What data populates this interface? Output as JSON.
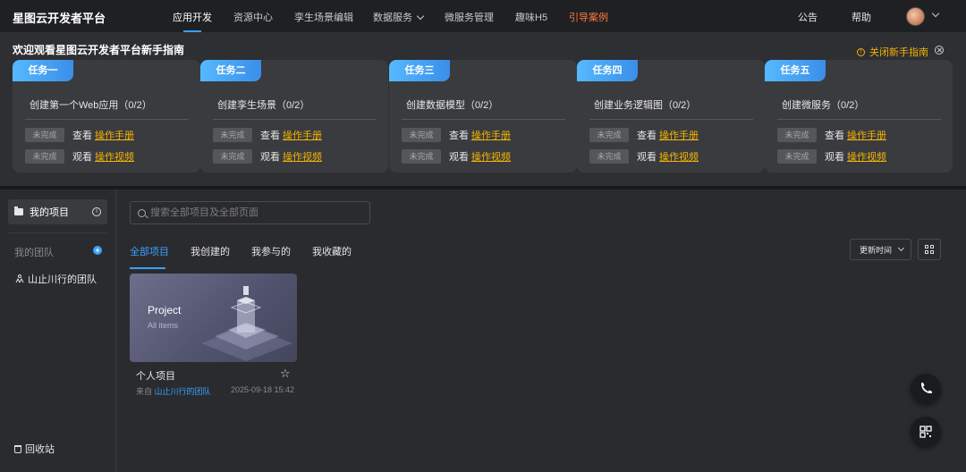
{
  "topnav": {
    "brand": "星图云开发者平台",
    "items": [
      "应用开发",
      "资源中心",
      "孪生场景编辑",
      "数据服务",
      "微服务管理",
      "趣味H5",
      "引导案例"
    ],
    "right": [
      "公告",
      "帮助"
    ]
  },
  "guide": {
    "title": "欢迎观看星图云开发者平台新手指南",
    "close_label": "关闭新手指南",
    "tasks": [
      {
        "tag": "任务一",
        "name": "创建第一个Web应用（0/2）"
      },
      {
        "tag": "任务二",
        "name": "创建孪生场景（0/2）"
      },
      {
        "tag": "任务三",
        "name": "创建数据模型（0/2）"
      },
      {
        "tag": "任务四",
        "name": "创建业务逻辑图（0/2）"
      },
      {
        "tag": "任务五",
        "name": "创建微服务（0/2）"
      }
    ],
    "status": "未完成",
    "view_label": "查看",
    "manual_link": "操作手册",
    "watch_label": "观看",
    "video_link": "操作视频"
  },
  "sidebar": {
    "my_projects": "我的项目",
    "my_team_label": "我的团队",
    "team_name": "山止川行的团队",
    "recycle": "回收站"
  },
  "main": {
    "search_placeholder": "搜索全部项目及全部页面",
    "tabs": [
      "全部项目",
      "我创建的",
      "我参与的",
      "我收藏的"
    ],
    "sort_label": "更新时间",
    "card": {
      "thumb_title": "Project",
      "thumb_sub": "All items",
      "name": "个人项目",
      "from_prefix": "来自",
      "from_team": "山止川行的团队",
      "date": "2025-09-18 15:42"
    }
  }
}
